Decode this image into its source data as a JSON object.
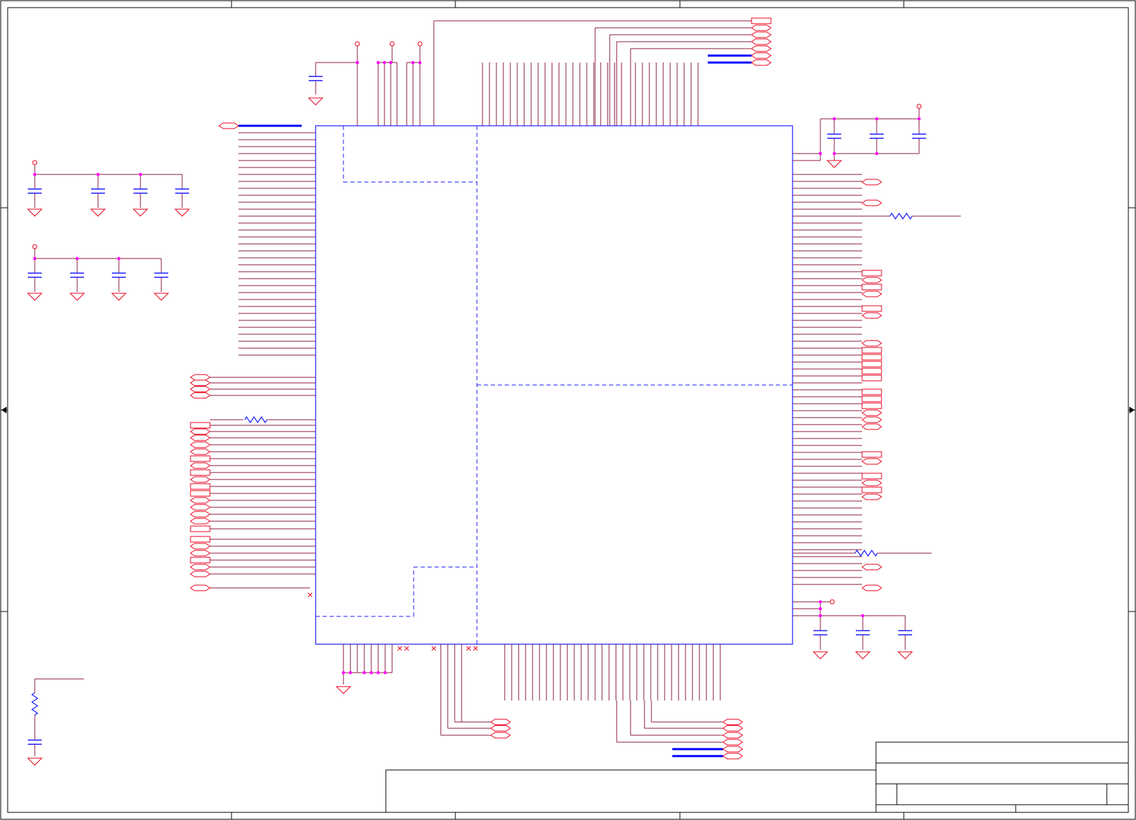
{
  "sheet": {
    "grid_columns": 5,
    "grid_rows": 4,
    "title_block_visible": true
  },
  "colors": {
    "background": "#ffffff",
    "border": "#000000",
    "wire": "#8b1a3c",
    "pin": "#8b1a3c",
    "symbol": "#e8001c",
    "junction": "#ff00ff",
    "ic_body": "#1a1aff",
    "bus": "#0000ff",
    "hidden_section": "#1a1aff"
  },
  "components": {
    "main_ic": "ic-symbol",
    "capacitor": "capacitor-symbol",
    "resistor": "resistor-symbol",
    "ground": "ground-symbol",
    "power": "power-port-symbol",
    "net_port": "net-port-symbol",
    "no_connect": "no-connect-marker"
  },
  "icons": [
    "capacitor-icon",
    "resistor-icon",
    "ground-icon",
    "power-port-icon",
    "net-port-icon",
    "no-connect-icon"
  ]
}
